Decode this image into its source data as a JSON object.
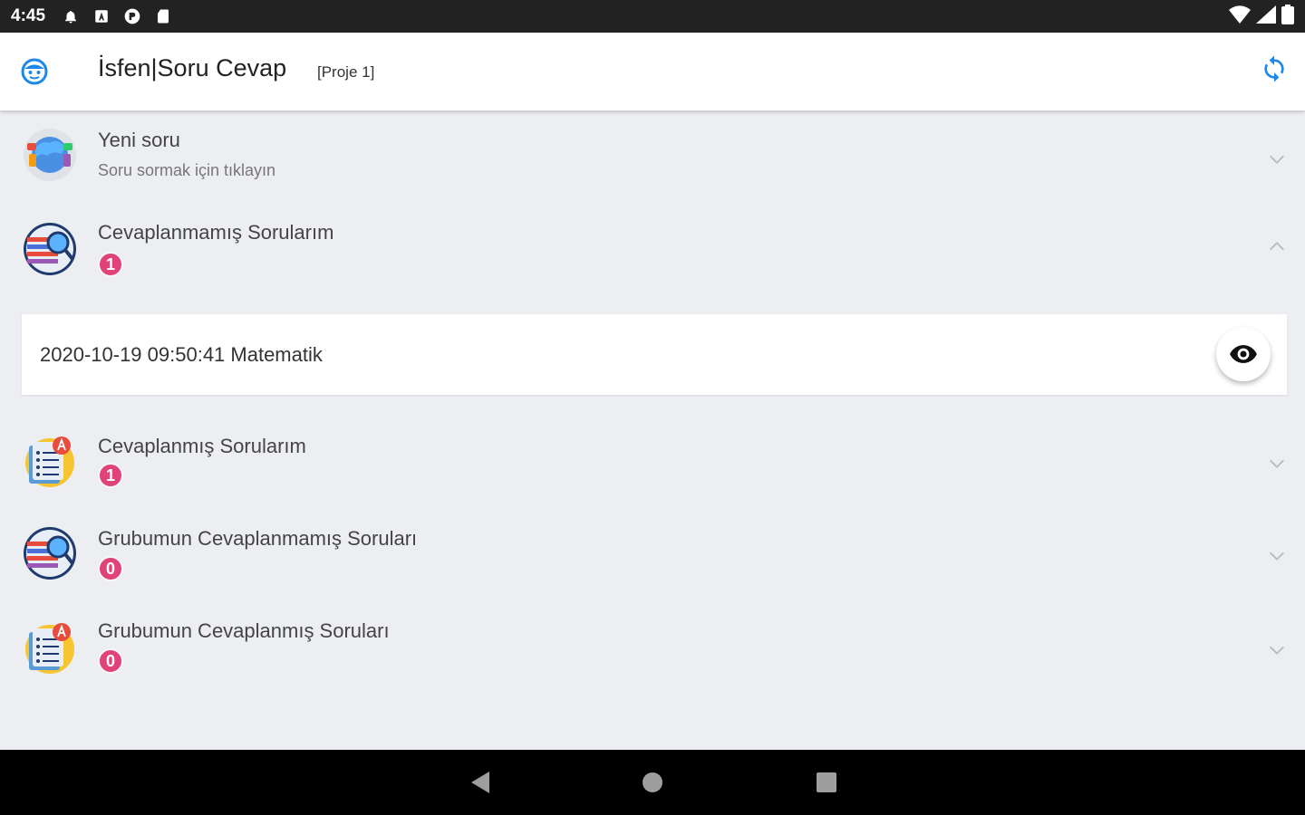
{
  "status_bar": {
    "time": "4:45",
    "icons": [
      "notification-bell-icon",
      "sim-a-icon",
      "media-icon",
      "sd-card-icon"
    ],
    "right_icons": [
      "wifi-icon",
      "signal-icon",
      "battery-icon"
    ]
  },
  "app_bar": {
    "title": "İsfen|Soru Cevap",
    "project": "[Proje 1]",
    "accent": "#1e88e5"
  },
  "items": [
    {
      "title": "Yeni soru",
      "subtitle": "Soru sormak için tıklayın",
      "icon": "new-question-icon",
      "expanded": false
    },
    {
      "title": "Cevaplanmamış Sorularım",
      "badge": "1",
      "icon": "unanswered-questions-icon",
      "expanded": true
    },
    {
      "title": "Cevaplanmış Sorularım",
      "badge": "1",
      "icon": "answered-questions-icon",
      "expanded": false
    },
    {
      "title": "Grubumun Cevaplanmamış Soruları",
      "badge": "0",
      "icon": "group-unanswered-icon",
      "expanded": false
    },
    {
      "title": "Grubumun Cevaplanmış Soruları",
      "badge": "0",
      "icon": "group-answered-icon",
      "expanded": false
    }
  ],
  "expanded_entry": {
    "text": "2020-10-19 09:50:41 Matematik",
    "action_icon": "eye-icon"
  },
  "colors": {
    "badge": "#e0437a",
    "background": "#eceef1"
  },
  "nav_bar": {
    "buttons": [
      "back-icon",
      "home-icon",
      "recents-icon"
    ]
  }
}
